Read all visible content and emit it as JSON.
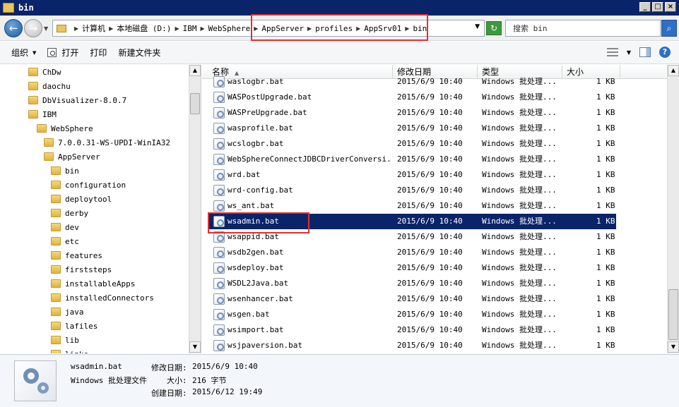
{
  "window": {
    "title": "bin"
  },
  "address": {
    "crumbs": [
      "计算机",
      "本地磁盘 (D:)",
      "IBM",
      "WebSphere",
      "AppServer",
      "profiles",
      "AppSrv01",
      "bin"
    ],
    "search_placeholder": "搜索 bin"
  },
  "toolbar": {
    "organize": "组织",
    "open": "打开",
    "print": "打印",
    "new_folder": "新建文件夹"
  },
  "tree": [
    {
      "label": "ChDw",
      "level": 0
    },
    {
      "label": "daochu",
      "level": 0
    },
    {
      "label": "DbVisualizer-8.0.7",
      "level": 0
    },
    {
      "label": "IBM",
      "level": 0
    },
    {
      "label": "WebSphere",
      "level": 1
    },
    {
      "label": "7.0.0.31-WS-UPDI-WinIA32",
      "level": 2
    },
    {
      "label": "AppServer",
      "level": 2
    },
    {
      "label": "bin",
      "level": 3
    },
    {
      "label": "configuration",
      "level": 3
    },
    {
      "label": "deploytool",
      "level": 3
    },
    {
      "label": "derby",
      "level": 3
    },
    {
      "label": "dev",
      "level": 3
    },
    {
      "label": "etc",
      "level": 3
    },
    {
      "label": "features",
      "level": 3
    },
    {
      "label": "firststeps",
      "level": 3
    },
    {
      "label": "installableApps",
      "level": 3
    },
    {
      "label": "installedConnectors",
      "level": 3
    },
    {
      "label": "java",
      "level": 3
    },
    {
      "label": "lafiles",
      "level": 3
    },
    {
      "label": "lib",
      "level": 3
    },
    {
      "label": "links",
      "level": 3
    }
  ],
  "columns": {
    "name": "名称",
    "date": "修改日期",
    "type": "类型",
    "size": "大小"
  },
  "files": [
    {
      "name": "waslogbr.bat",
      "date": "2015/6/9 10:40",
      "type": "Windows 批处理...",
      "size": "1 KB"
    },
    {
      "name": "WASPostUpgrade.bat",
      "date": "2015/6/9 10:40",
      "type": "Windows 批处理...",
      "size": "1 KB"
    },
    {
      "name": "WASPreUpgrade.bat",
      "date": "2015/6/9 10:40",
      "type": "Windows 批处理...",
      "size": "1 KB"
    },
    {
      "name": "wasprofile.bat",
      "date": "2015/6/9 10:40",
      "type": "Windows 批处理...",
      "size": "1 KB"
    },
    {
      "name": "wcslogbr.bat",
      "date": "2015/6/9 10:40",
      "type": "Windows 批处理...",
      "size": "1 KB"
    },
    {
      "name": "WebSphereConnectJDBCDriverConversi...",
      "date": "2015/6/9 10:40",
      "type": "Windows 批处理...",
      "size": "1 KB"
    },
    {
      "name": "wrd.bat",
      "date": "2015/6/9 10:40",
      "type": "Windows 批处理...",
      "size": "1 KB"
    },
    {
      "name": "wrd-config.bat",
      "date": "2015/6/9 10:40",
      "type": "Windows 批处理...",
      "size": "1 KB"
    },
    {
      "name": "ws_ant.bat",
      "date": "2015/6/9 10:40",
      "type": "Windows 批处理...",
      "size": "1 KB"
    },
    {
      "name": "wsadmin.bat",
      "date": "2015/6/9 10:40",
      "type": "Windows 批处理...",
      "size": "1 KB",
      "selected": true
    },
    {
      "name": "wsappid.bat",
      "date": "2015/6/9 10:40",
      "type": "Windows 批处理...",
      "size": "1 KB"
    },
    {
      "name": "wsdb2gen.bat",
      "date": "2015/6/9 10:40",
      "type": "Windows 批处理...",
      "size": "1 KB"
    },
    {
      "name": "wsdeploy.bat",
      "date": "2015/6/9 10:40",
      "type": "Windows 批处理...",
      "size": "1 KB"
    },
    {
      "name": "WSDL2Java.bat",
      "date": "2015/6/9 10:40",
      "type": "Windows 批处理...",
      "size": "1 KB"
    },
    {
      "name": "wsenhancer.bat",
      "date": "2015/6/9 10:40",
      "type": "Windows 批处理...",
      "size": "1 KB"
    },
    {
      "name": "wsgen.bat",
      "date": "2015/6/9 10:40",
      "type": "Windows 批处理...",
      "size": "1 KB"
    },
    {
      "name": "wsimport.bat",
      "date": "2015/6/9 10:40",
      "type": "Windows 批处理...",
      "size": "1 KB"
    },
    {
      "name": "wsjpaversion.bat",
      "date": "2015/6/9 10:40",
      "type": "Windows 批处理...",
      "size": "1 KB"
    }
  ],
  "details": {
    "filename": "wsadmin.bat",
    "filetype": "Windows 批处理文件",
    "modified_label": "修改日期:",
    "modified_value": "2015/6/9 10:40",
    "size_label": "大小:",
    "size_value": "216 字节",
    "created_label": "创建日期:",
    "created_value": "2015/6/12 19:49"
  },
  "colors": {
    "selection": "#0a246a",
    "highlight_box": "#e03030"
  }
}
